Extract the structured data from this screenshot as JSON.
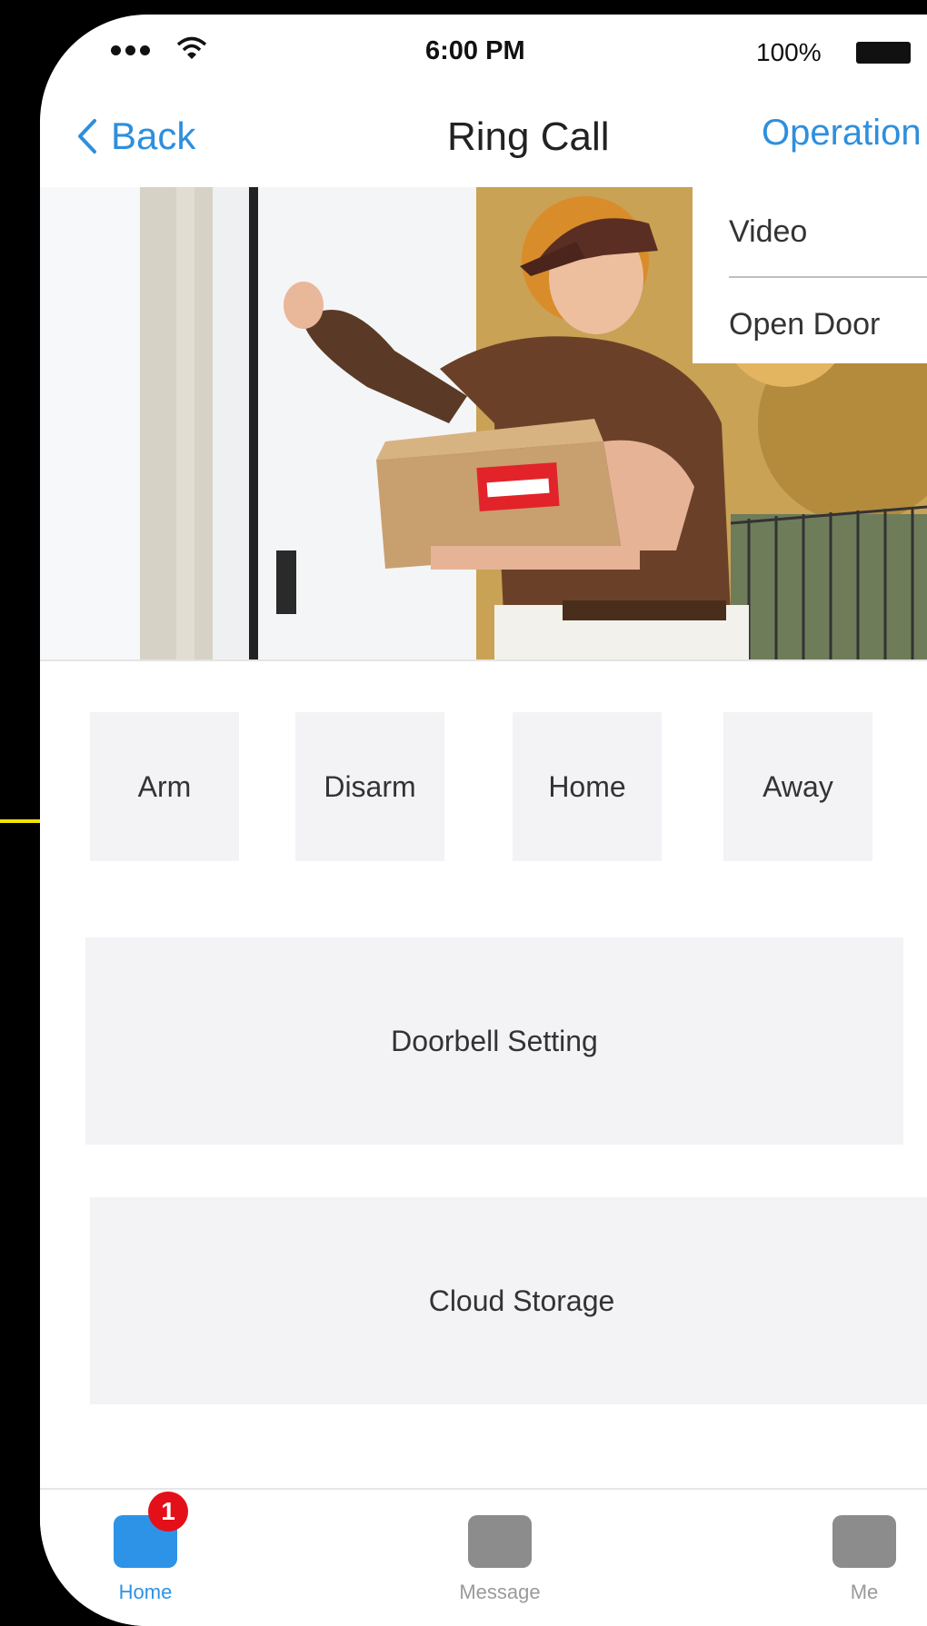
{
  "status_bar": {
    "time": "6:00 PM",
    "battery": "100%"
  },
  "nav": {
    "back_label": "Back",
    "title": "Ring Call",
    "operation_label": "Operation"
  },
  "dropdown": {
    "items": [
      "Video",
      "Open Door"
    ]
  },
  "modes": [
    {
      "label": "Arm"
    },
    {
      "label": "Disarm"
    },
    {
      "label": "Home"
    },
    {
      "label": "Away"
    }
  ],
  "actions": {
    "doorbell_setting": "Doorbell Setting",
    "cloud_storage": "Cloud Storage"
  },
  "tabs": [
    {
      "label": "Home",
      "badge": "1",
      "active": true
    },
    {
      "label": "Message"
    },
    {
      "label": "Me"
    }
  ],
  "colors": {
    "accent": "#2e8fdc",
    "badge": "#e3101a",
    "button_bg": "#f3f3f6"
  },
  "icons": [
    "signal-dots-icon",
    "wifi-icon",
    "battery-icon",
    "back-chevron-icon"
  ]
}
